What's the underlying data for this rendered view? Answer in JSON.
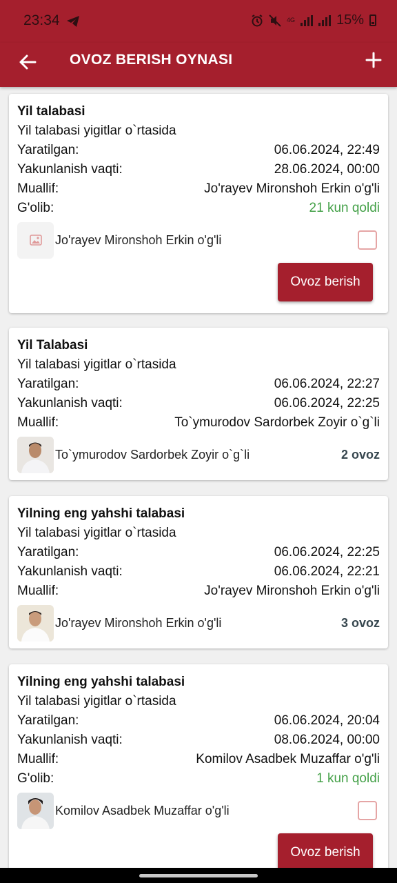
{
  "status": {
    "time": "23:34",
    "network": "4G",
    "battery": "15%",
    "icons": [
      "telegram-icon",
      "alarm-icon",
      "mute-icon",
      "signal-icon",
      "battery-icon"
    ]
  },
  "appbar": {
    "title": "OVOZ BERISH OYNASI",
    "back_icon": "arrow-left-icon",
    "add_icon": "plus-icon"
  },
  "labels": {
    "created": "Yaratilgan:",
    "ends": "Yakunlanish vaqti:",
    "author": "Muallif:",
    "winner": "G'olib:",
    "vote_button": "Ovoz berish"
  },
  "polls": [
    {
      "title": "Yil talabasi",
      "subtitle": "Yil talabasi yigitlar o`rtasida",
      "created": "06.06.2024, 22:49",
      "ends": "28.06.2024, 00:00",
      "author": "Jo'rayev Mironshoh Erkin o'g'li",
      "winner": "21 kun qoldi",
      "candidate": "Jo'rayev Mironshoh Erkin o'g'li"
    },
    {
      "title": "Yil Talabasi",
      "subtitle": "Yil talabasi yigitlar o`rtasida",
      "created": "06.06.2024, 22:27",
      "ends": "06.06.2024, 22:25",
      "author": "To`ymurodov Sardorbek Zoyir o`g`li",
      "candidate": "To`ymurodov Sardorbek Zoyir o`g`li",
      "votes": "2 ovoz"
    },
    {
      "title": "Yilning eng yahshi talabasi",
      "subtitle": "Yil talabasi yigitlar o`rtasida",
      "created": "06.06.2024, 22:25",
      "ends": "06.06.2024, 22:21",
      "author": "Jo'rayev Mironshoh Erkin o'g'li",
      "candidate": "Jo'rayev Mironshoh Erkin o'g'li",
      "votes": "3 ovoz"
    },
    {
      "title": "Yilning eng yahshi talabasi",
      "subtitle": "Yil talabasi yigitlar o`rtasida",
      "created": "06.06.2024, 20:04",
      "ends": "08.06.2024, 00:00",
      "author": "Komilov Asadbek Muzaffar o'g'li",
      "winner": "1 kun qoldi",
      "candidate": "Komilov Asadbek Muzaffar o'g'li"
    }
  ],
  "colors": {
    "primary": "#a51f2d",
    "success": "#43a047",
    "votes_text": "#37474f"
  }
}
